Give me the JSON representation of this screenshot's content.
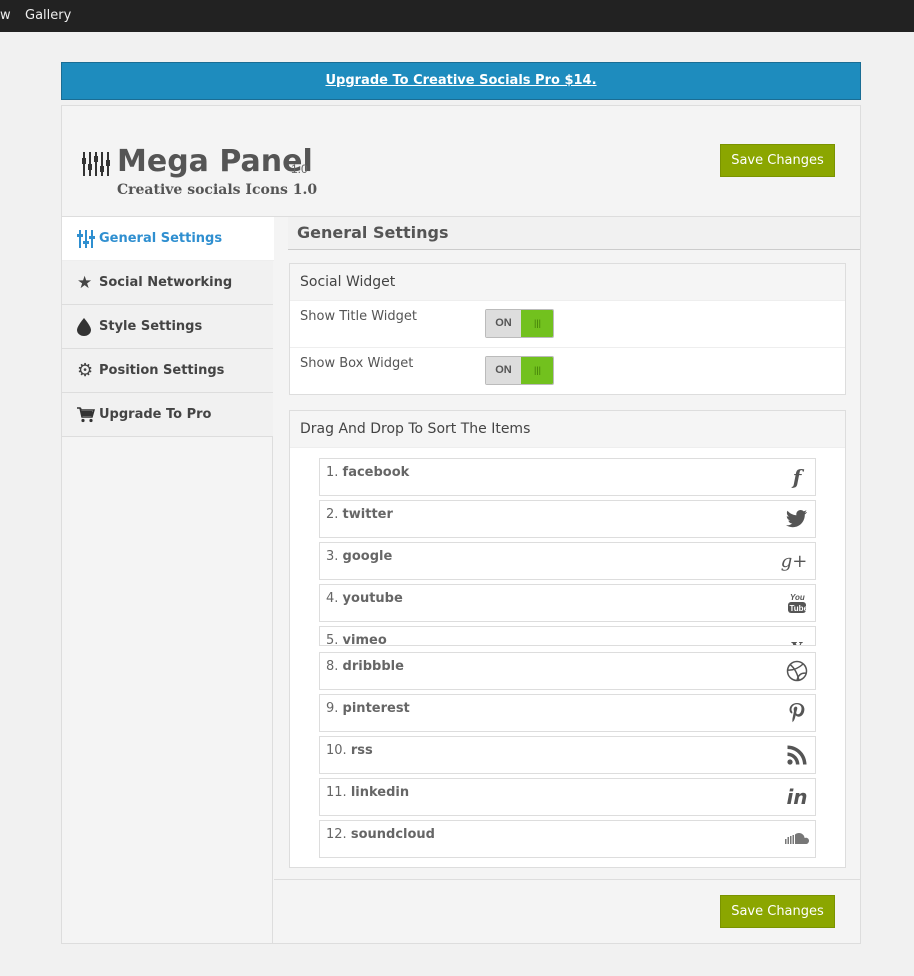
{
  "topbar": {
    "item_1": "w",
    "item_2": "Gallery"
  },
  "banner": {
    "text": "Upgrade To Creative Socials Pro $14."
  },
  "header": {
    "title": "Mega Panel",
    "version": "1.0",
    "subtitle": "Creative socials Icons 1.0",
    "save_label": "Save Changes"
  },
  "sidebar": {
    "items": [
      {
        "label": "General Settings",
        "icon": "sliders-icon"
      },
      {
        "label": "Social Networking",
        "icon": "star-icon"
      },
      {
        "label": "Style Settings",
        "icon": "drop-icon"
      },
      {
        "label": "Position Settings",
        "icon": "gear-icon"
      },
      {
        "label": "Upgrade To Pro",
        "icon": "cart-icon"
      }
    ]
  },
  "main": {
    "section_title": "General Settings",
    "widget_box": {
      "title": "Social Widget",
      "rows": [
        {
          "label": "Show Title Widget",
          "toggle": "ON",
          "knob": "|||"
        },
        {
          "label": "Show Box Widget",
          "toggle": "ON",
          "knob": "|||"
        }
      ]
    },
    "sort_box": {
      "title": "Drag And Drop To Sort The Items",
      "items": [
        {
          "num": "1.",
          "name": "facebook",
          "icon": "f"
        },
        {
          "num": "2.",
          "name": "twitter",
          "icon": "twitter-icon"
        },
        {
          "num": "3.",
          "name": "google",
          "icon": "g+"
        },
        {
          "num": "4.",
          "name": "youtube",
          "icon": "youtube-icon"
        },
        {
          "num": "5.",
          "name": "vimeo",
          "icon": "vimeo-icon"
        },
        {
          "num": "8.",
          "name": "dribbble",
          "icon": "dribbble-icon"
        },
        {
          "num": "9.",
          "name": "pinterest",
          "icon": "pinterest-icon"
        },
        {
          "num": "10.",
          "name": "rss",
          "icon": "rss-icon"
        },
        {
          "num": "11.",
          "name": "linkedin",
          "icon": "in"
        },
        {
          "num": "12.",
          "name": "soundcloud",
          "icon": "soundcloud-icon"
        }
      ]
    }
  },
  "footer": {
    "save_label": "Save Changes"
  },
  "colors": {
    "banner": "#1e8cbe",
    "save": "#8ba600",
    "toggle_on": "#72c11e",
    "active_nav": "#2f8fd0"
  }
}
